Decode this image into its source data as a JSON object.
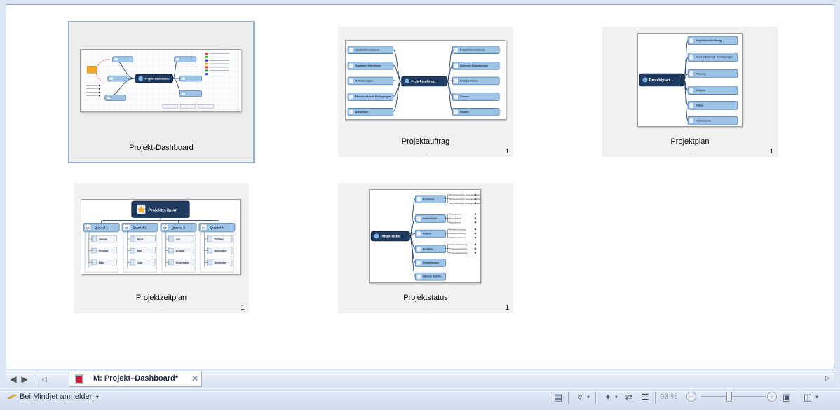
{
  "tabs": [
    {
      "label": "M: Projekt–Dashboard*",
      "active": true
    }
  ],
  "slides": [
    {
      "title": "Projekt-Dashboard",
      "page": "",
      "selected": true
    },
    {
      "title": "Projektauftrag",
      "page": "1",
      "selected": false
    },
    {
      "title": "Projektplan",
      "page": "1",
      "selected": false
    },
    {
      "title": "Projektzeitplan",
      "page": "1",
      "selected": false
    },
    {
      "title": "Projektstatus",
      "page": "1",
      "selected": false
    }
  ],
  "thumbs": {
    "dashboard": {
      "center": "Projekt-Dashboard"
    },
    "auftrag": {
      "center": "Projektauftrag",
      "left": [
        "Zusatzinformationen",
        "Geplanter Zeitrahmen",
        "Anforderungen",
        "Einschränkende Bedingungen",
        "Annahmen"
      ],
      "right": [
        "Projektinformationen",
        "Ziele und Zielsetzungen",
        "Erfolgskriterien",
        "Chance",
        "Risiken"
      ]
    },
    "plan": {
      "center": "Projektplan",
      "items": [
        "Projektbeschreibung",
        "Einschränkende Bedingungen",
        "Planung",
        "Zeitplan",
        "Status",
        "Fehlersuche"
      ]
    },
    "zeitplan": {
      "center": "Projektzeitplan",
      "quarters": [
        {
          "label": "Quartal 1",
          "badge": "Q1",
          "months": [
            "Januar",
            "Februar",
            "März"
          ]
        },
        {
          "label": "Quartal 2",
          "badge": "Q2",
          "months": [
            "April",
            "Mai",
            "Juni"
          ]
        },
        {
          "label": "Quartal 3",
          "badge": "Q3",
          "months": [
            "Juli",
            "August",
            "September"
          ]
        },
        {
          "label": "Quartal 4",
          "badge": "Q4",
          "months": [
            "Oktober",
            "November",
            "Dezember"
          ]
        }
      ]
    },
    "status": {
      "center": "Projektstatus",
      "items": [
        "Erreichtes",
        "Finanzstatus",
        "Risiken",
        "Probleme",
        "Empfehlungen",
        "Nächste Schritte"
      ],
      "subs": [
        [
          "Beschreibung des Liefergegenstandes",
          "Beschreibung des Liefergegenstandes",
          "Beschreibung des Liefergegenstandes"
        ],
        [
          "Budgetposten",
          "Budgetposten",
          "Budgetposten"
        ],
        [
          "Risikobeschreibung",
          "Risikobeschreibung",
          "Risikobeschreibung"
        ],
        [
          "Problembeschreibung",
          "Problembeschreibung",
          "Problembeschreibung"
        ]
      ]
    }
  },
  "statusbar": {
    "login_label": "Bei Mindjet anmelden",
    "zoom": "93 %"
  },
  "icons": {
    "nav_back": "arrow-left-icon",
    "nav_forward": "arrow-right-icon",
    "filter": "filter-icon"
  },
  "colors": {
    "node_blue": "#9dc3e6",
    "node_border": "#2f5b8a",
    "center_dark": "#1f3a5f",
    "selection": "#9ab0cc"
  }
}
